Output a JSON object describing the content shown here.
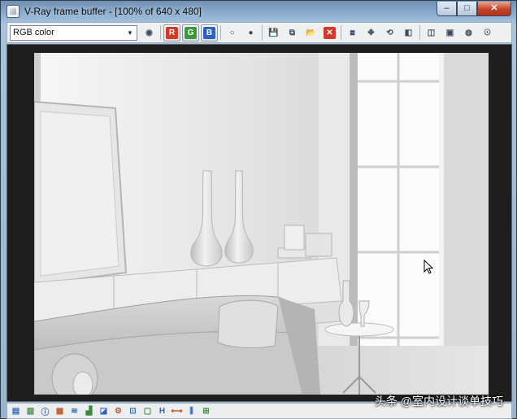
{
  "window": {
    "title": "V-Ray frame buffer - [100% of 640 x 480]",
    "controls": {
      "minimize": "‒",
      "maximize": "□",
      "close": "✕"
    }
  },
  "toolbar": {
    "channel_select_value": "RGB color",
    "buttons": [
      {
        "name": "color-picker-icon",
        "glyph": "◉"
      },
      {
        "name": "red-channel-button",
        "glyph": "R",
        "color": "#d13a2b"
      },
      {
        "name": "green-channel-button",
        "glyph": "G",
        "color": "#3d9a3a"
      },
      {
        "name": "blue-channel-button",
        "glyph": "B",
        "color": "#2f5fc0"
      },
      {
        "name": "white-circle-icon",
        "glyph": "○"
      },
      {
        "name": "mono-circle-icon",
        "glyph": "●"
      },
      {
        "name": "save-image-icon",
        "glyph": "💾"
      },
      {
        "name": "duplicate-image-icon",
        "glyph": "⧉"
      },
      {
        "name": "open-image-icon",
        "glyph": "📂"
      },
      {
        "name": "clear-image-icon",
        "glyph": "✕",
        "color": "#d23b2a"
      },
      {
        "name": "copy-to-max-icon",
        "glyph": "⧈"
      },
      {
        "name": "track-mouse-icon",
        "glyph": "✥"
      },
      {
        "name": "render-last-icon",
        "glyph": "⟲"
      },
      {
        "name": "stereo-icon",
        "glyph": "◧"
      },
      {
        "name": "region-render-icon",
        "glyph": "◫"
      },
      {
        "name": "correction-panel-icon",
        "glyph": "▣"
      },
      {
        "name": "teapot-icon",
        "glyph": "◍"
      },
      {
        "name": "bucket-icon",
        "glyph": "☉"
      }
    ]
  },
  "statusbar": {
    "buttons": [
      {
        "name": "display-lut-icon",
        "glyph": "▤"
      },
      {
        "name": "srgb-icon",
        "glyph": "▥"
      },
      {
        "name": "info-icon",
        "glyph": "ⓘ"
      },
      {
        "name": "levels-icon",
        "glyph": "▦"
      },
      {
        "name": "curves-icon",
        "glyph": "≋"
      },
      {
        "name": "histogram-icon",
        "glyph": "▟"
      },
      {
        "name": "exposure-icon",
        "glyph": "◪"
      },
      {
        "name": "gear-icon",
        "glyph": "⚙"
      },
      {
        "name": "crop-icon",
        "glyph": "⊡"
      },
      {
        "name": "pixel-info-icon",
        "glyph": "▢"
      },
      {
        "name": "horizontal-flip-icon",
        "glyph": "H"
      },
      {
        "name": "fit-width-icon",
        "glyph": "⟷"
      },
      {
        "name": "compare-icon",
        "glyph": "⫼"
      },
      {
        "name": "fullscreen-icon",
        "glyph": "⊞"
      }
    ]
  },
  "watermark": {
    "text": "头条 @室内设计谈单技巧"
  }
}
